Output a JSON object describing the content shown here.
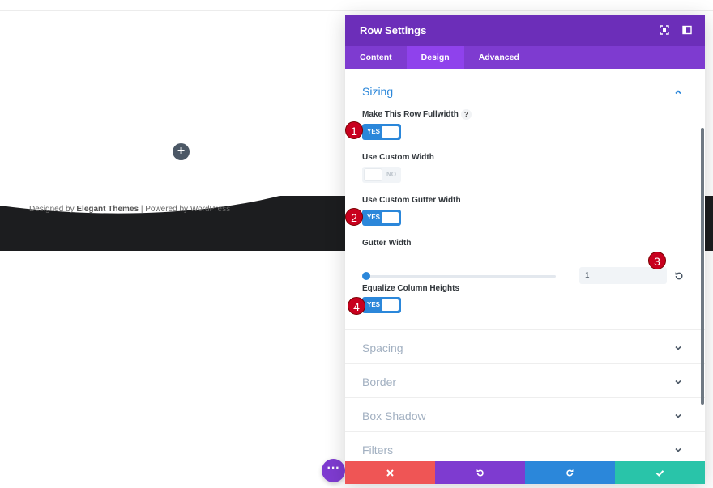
{
  "background_page": {
    "add_module_icon": "plus-icon",
    "footer_text_prefix": "Designed by ",
    "footer_brand": "Elegant Themes",
    "footer_text_suffix": " | Powered by WordPress",
    "fab_icon": "ellipsis-icon"
  },
  "modal": {
    "title": "Row Settings",
    "header_icons": [
      "fullscreen-icon",
      "sidebar-layout-icon"
    ],
    "tabs": [
      {
        "label": "Content",
        "active": false
      },
      {
        "label": "Design",
        "active": true
      },
      {
        "label": "Advanced",
        "active": false
      }
    ],
    "sizing": {
      "title": "Sizing",
      "fullwidth_label": "Make This Row Fullwidth",
      "fullwidth_help": "?",
      "fullwidth_value": "YES",
      "custom_width_label": "Use Custom Width",
      "custom_width_value": "NO",
      "custom_gutter_label": "Use Custom Gutter Width",
      "custom_gutter_value": "YES",
      "gutter_width_label": "Gutter Width",
      "gutter_width_value": "1",
      "gutter_slider_fraction": 0,
      "equalize_label": "Equalize Column Heights",
      "equalize_value": "YES"
    },
    "collapsed_sections": [
      "Spacing",
      "Border",
      "Box Shadow",
      "Filters"
    ],
    "footer_buttons": [
      "close-icon",
      "undo-icon",
      "redo-icon",
      "check-icon"
    ]
  },
  "annotations": [
    "1",
    "2",
    "3",
    "4"
  ],
  "colors": {
    "purple_dark": "#6c2eb9",
    "purple": "#7e3bd0",
    "blue": "#2b87da",
    "red": "#ef5555",
    "green": "#29c4a9",
    "badge_red": "#c8001e"
  }
}
